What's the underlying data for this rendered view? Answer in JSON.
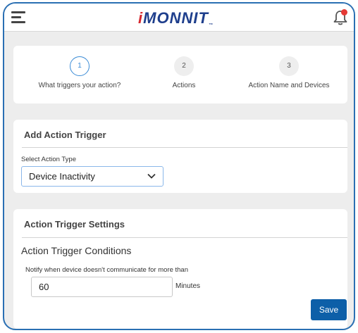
{
  "header": {
    "logo_prefix": "i",
    "logo_text": "MONNIT",
    "logo_tm": "™",
    "menu_icon": "hamburger-menu-icon",
    "notification_icon": "bell-icon",
    "notification_dot_color": "#e53935"
  },
  "steps": [
    {
      "number": "1",
      "label": "What triggers your action?",
      "active": true
    },
    {
      "number": "2",
      "label": "Actions",
      "active": false
    },
    {
      "number": "3",
      "label": "Action Name and Devices",
      "active": false
    }
  ],
  "trigger_card": {
    "title": "Add Action Trigger",
    "select_label": "Select Action Type",
    "select_value": "Device Inactivity"
  },
  "settings_card": {
    "title": "Action Trigger Settings",
    "conditions_title": "Action Trigger Conditions",
    "notify_label": "Notify when device doesn't communicate for more than",
    "notify_value": "60",
    "notify_unit": "Minutes",
    "save_label": "Save"
  },
  "colors": {
    "frame_border": "#2a6fb3",
    "brand_blue": "#1e3e8c",
    "brand_red": "#d7282f",
    "primary_button": "#0d5fa8",
    "active_step": "#3a8bd6"
  }
}
